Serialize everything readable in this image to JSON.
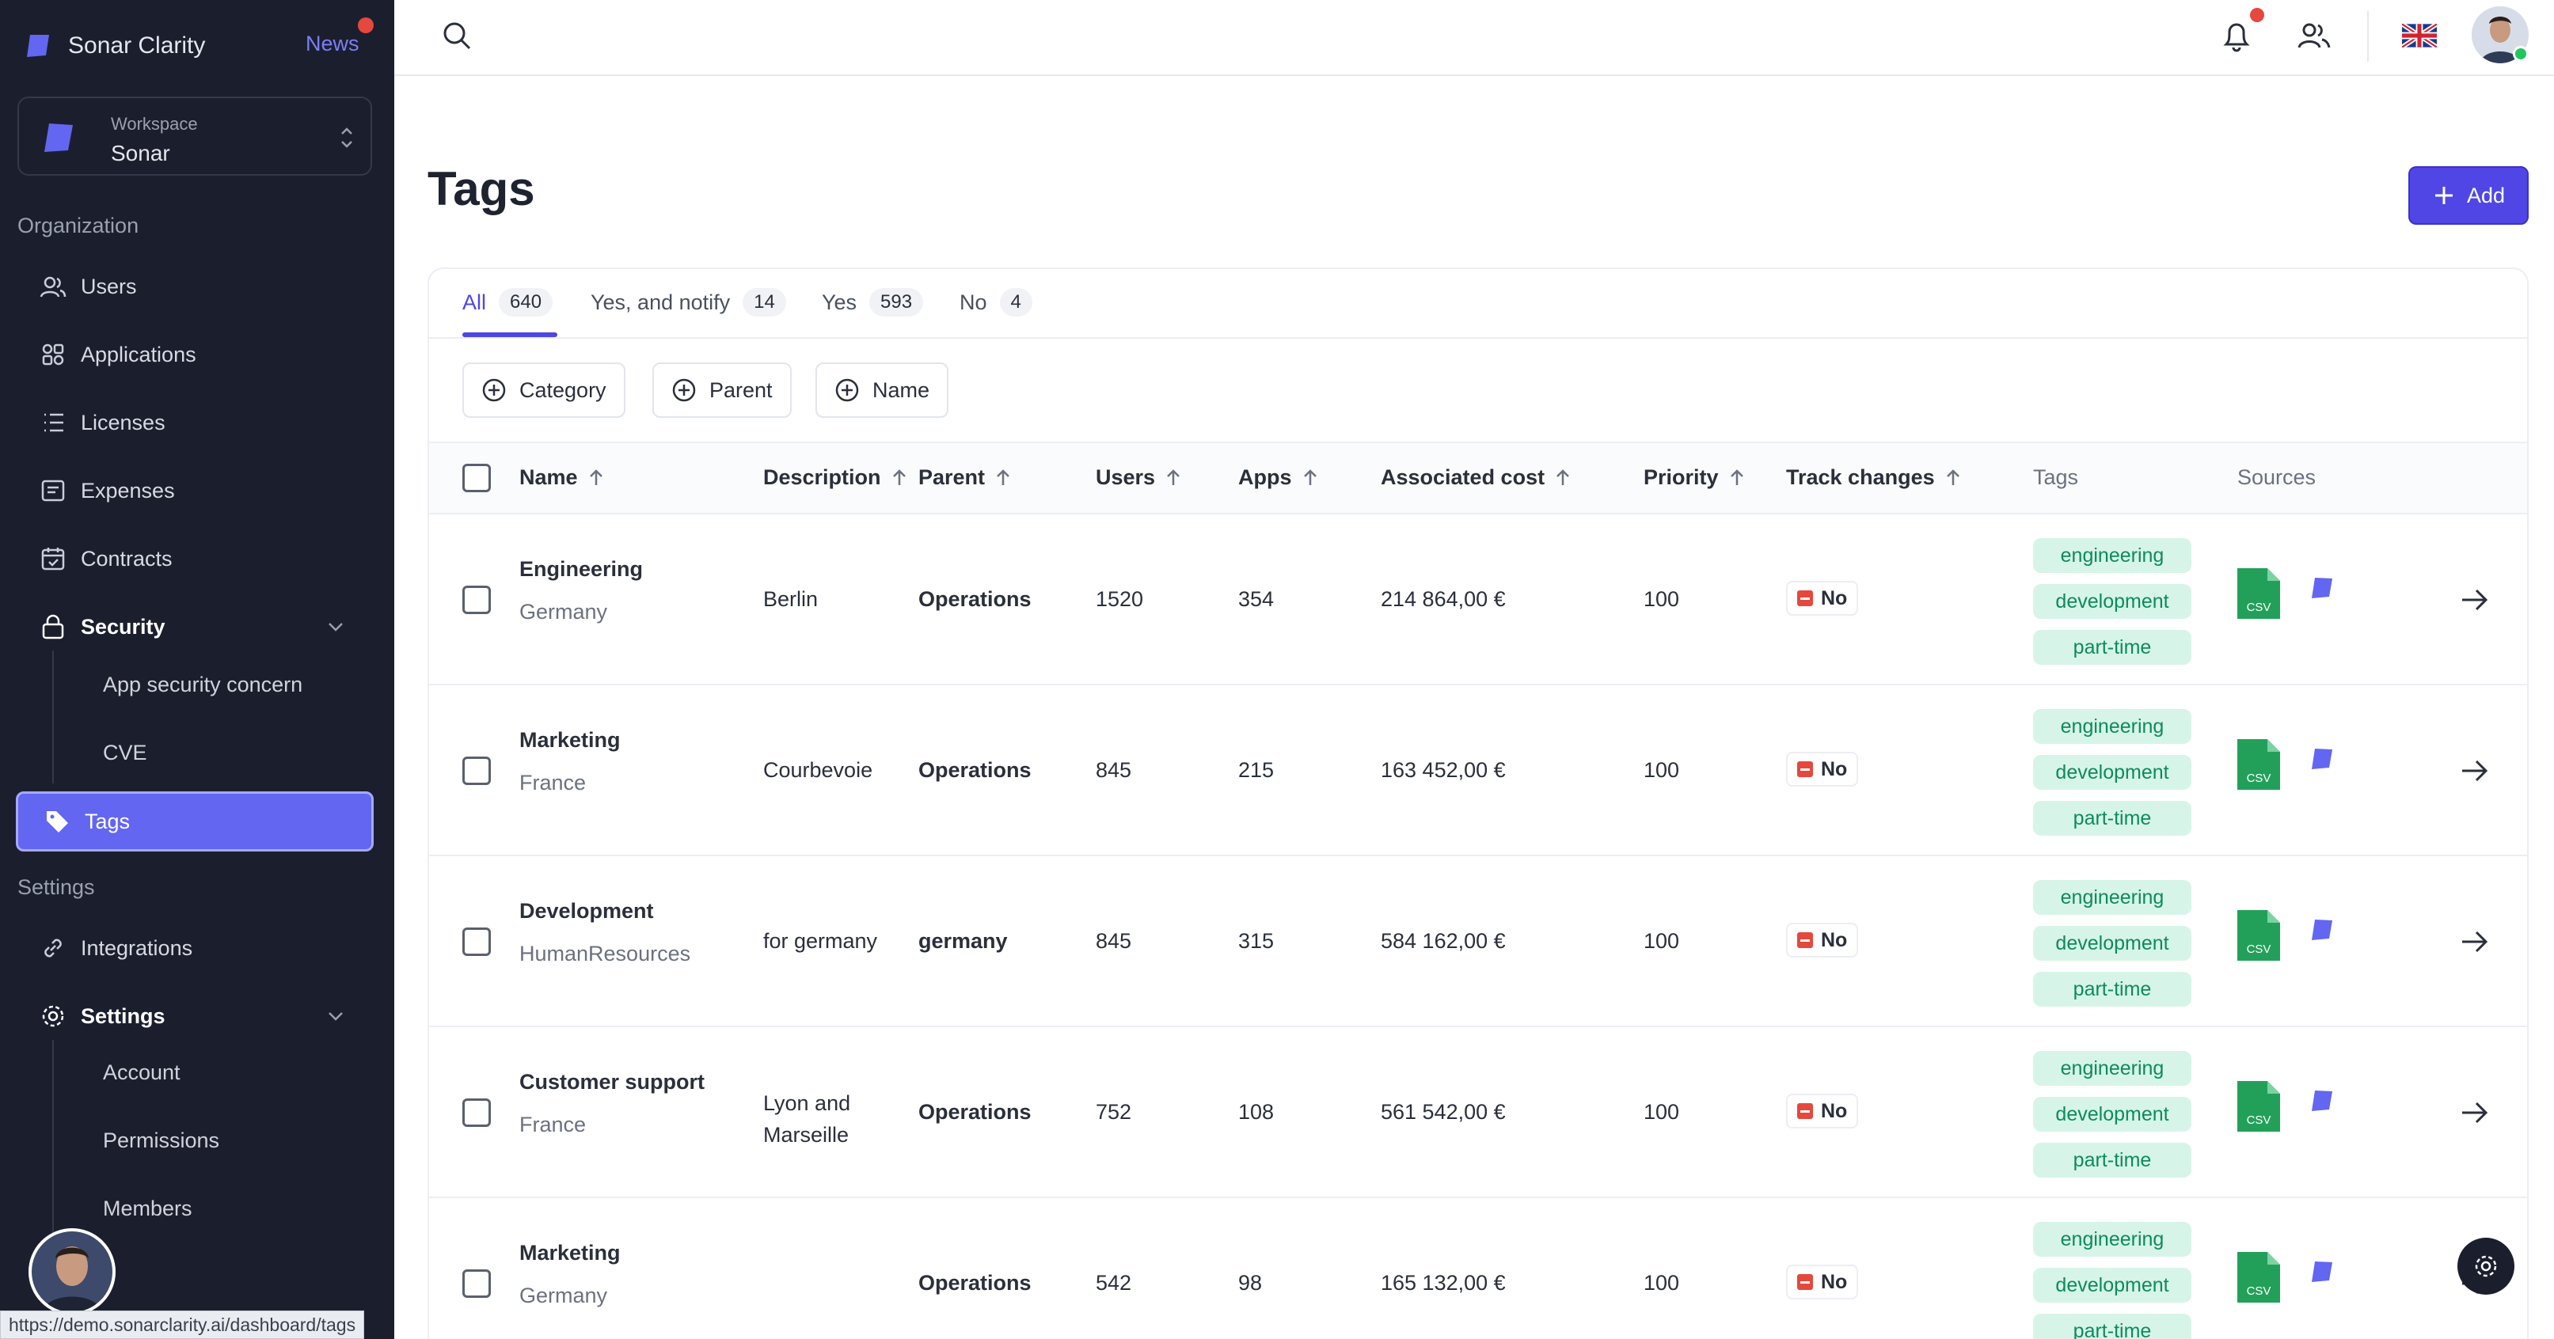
{
  "app": {
    "name": "Sonar Clarity",
    "news": "News"
  },
  "workspace": {
    "label": "Workspace",
    "name": "Sonar"
  },
  "sidebar": {
    "organization_title": "Organization",
    "items": [
      {
        "label": "Users",
        "icon": "users-icon"
      },
      {
        "label": "Applications",
        "icon": "applications-icon"
      },
      {
        "label": "Licenses",
        "icon": "list-icon"
      },
      {
        "label": "Expenses",
        "icon": "receipt-icon"
      },
      {
        "label": "Contracts",
        "icon": "calendar-check-icon"
      },
      {
        "label": "Security",
        "icon": "lock-icon"
      }
    ],
    "security_sub": [
      "App security concern",
      "CVE"
    ],
    "active": {
      "label": "Tags",
      "icon": "tag-icon"
    },
    "settings_title": "Settings",
    "settings_items": [
      {
        "label": "Integrations",
        "icon": "link-icon"
      },
      {
        "label": "Settings",
        "icon": "gear-icon"
      }
    ],
    "settings_sub": [
      "Account",
      "Permissions",
      "Members"
    ]
  },
  "status_url": "https://demo.sonarclarity.ai/dashboard/tags",
  "page": {
    "title": "Tags",
    "add_label": "Add"
  },
  "tabs": [
    {
      "label": "All",
      "count": "640"
    },
    {
      "label": "Yes, and notify",
      "count": "14"
    },
    {
      "label": "Yes",
      "count": "593"
    },
    {
      "label": "No",
      "count": "4"
    }
  ],
  "filters": [
    "Category",
    "Parent",
    "Name"
  ],
  "columns": {
    "name": "Name",
    "description": "Description",
    "parent": "Parent",
    "users": "Users",
    "apps": "Apps",
    "cost": "Associated cost",
    "priority": "Priority",
    "track": "Track changes",
    "tags": "Tags",
    "sources": "Sources"
  },
  "rows": [
    {
      "name": "Engineering",
      "location": "Germany",
      "description": "Berlin",
      "parent": "Operations",
      "users": "1520",
      "apps": "354",
      "cost": "214 864,00 €",
      "priority": "100",
      "track": "No",
      "tags": [
        "engineering",
        "development",
        "part-time"
      ]
    },
    {
      "name": "Marketing",
      "location": "France",
      "description": "Courbevoie",
      "parent": "Operations",
      "users": "845",
      "apps": "215",
      "cost": "163 452,00 €",
      "priority": "100",
      "track": "No",
      "tags": [
        "engineering",
        "development",
        "part-time"
      ]
    },
    {
      "name": "Development",
      "location": "HumanResources",
      "description": "for germany",
      "parent": "germany",
      "users": "845",
      "apps": "315",
      "cost": "584 162,00 €",
      "priority": "100",
      "track": "No",
      "tags": [
        "engineering",
        "development",
        "part-time"
      ]
    },
    {
      "name": "Customer support",
      "location": "France",
      "description": "Lyon and Marseille",
      "parent": "Operations",
      "users": "752",
      "apps": "108",
      "cost": "561 542,00 €",
      "priority": "100",
      "track": "No",
      "tags": [
        "engineering",
        "development",
        "part-time"
      ]
    },
    {
      "name": "Marketing",
      "location": "Germany",
      "description": "",
      "parent": "Operations",
      "users": "542",
      "apps": "98",
      "cost": "165 132,00 €",
      "priority": "100",
      "track": "No",
      "tags": [
        "engineering",
        "development",
        "part-time"
      ]
    }
  ],
  "sources": {
    "csv_label": "CSV"
  },
  "colors": {
    "accent": "#4f46e5",
    "sidebar": "#1b1f2d",
    "tag_bg": "#d6f5e8",
    "tag_text": "#0e8a5f",
    "danger": "#e5483d"
  }
}
